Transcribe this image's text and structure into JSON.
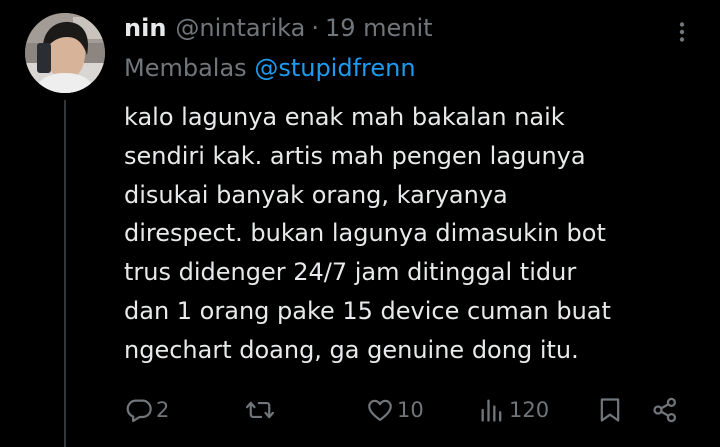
{
  "tweet": {
    "display_name": "nin",
    "handle": "@nintarika",
    "separator": "·",
    "time": "19 menit",
    "reply_prefix": "Membalas",
    "reply_to": "@stupidfrenn",
    "body_lines": [
      "kalo lagunya enak mah bakalan naik",
      "sendiri kak. artis mah pengen lagunya",
      "disukai banyak orang, karyanya",
      "direspect. bukan lagunya dimasukin bot",
      "trus didenger 24/7 jam ditinggal tidur",
      "dan 1 orang pake 15 device cuman buat",
      "ngechart doang, ga genuine dong itu."
    ]
  },
  "actions": {
    "replies": "2",
    "retweets": "",
    "likes": "10",
    "views": "120"
  },
  "icons": {
    "more": "more-options-icon",
    "reply": "reply-icon",
    "retweet": "retweet-icon",
    "like": "heart-icon",
    "views": "views-icon",
    "bookmark": "bookmark-icon",
    "share": "share-icon"
  },
  "colors": {
    "background": "#000000",
    "text": "#e7e9ea",
    "muted": "#71767b",
    "accent": "#1d9bf0"
  }
}
